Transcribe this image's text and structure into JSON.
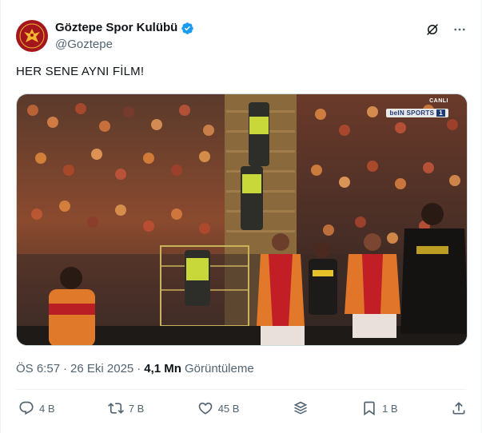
{
  "account": {
    "display_name": "Göztepe Spor Kulübü",
    "handle": "@Goztepe",
    "avatar_icon": "phoenix-crest-icon",
    "brand_color": "#a3161c",
    "verified_color": "#1d9bf0"
  },
  "tweet": {
    "text": "HER SENE AYNI FİLM!"
  },
  "media": {
    "broadcast_live": "CANLI",
    "broadcast_channel": "beIN SPORTS",
    "broadcast_channel_number": "1"
  },
  "meta": {
    "time": "ÖS 6:57",
    "separator": "·",
    "date": "26 Eki 2025",
    "views_count": "4,1 Mn",
    "views_label": "Görüntüleme"
  },
  "actions": {
    "replies": "4 B",
    "reposts": "7 B",
    "likes": "45 B",
    "bookmarks": "1 B"
  },
  "icons": {
    "grok": "grok-icon",
    "more": "more-icon",
    "reply": "reply-icon",
    "repost": "repost-icon",
    "like": "heart-icon",
    "layers": "layers-icon",
    "bookmark": "bookmark-icon",
    "share": "share-icon"
  }
}
